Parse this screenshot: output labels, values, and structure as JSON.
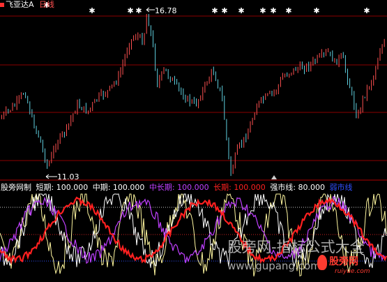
{
  "header": {
    "stock_icon": "red-square-icon",
    "stock_name": "飞亚达A",
    "period": "日线"
  },
  "price_panel": {
    "high_marker": "16.78",
    "low_marker": "11.03",
    "colors": {
      "up": "#ff5050",
      "down": "#5fd0e0",
      "grid": "#8b0000",
      "marker": "#ffffff"
    }
  },
  "indicator_panel": {
    "name": "股旁网制",
    "params": [
      {
        "label": "短期",
        "value": "100.000",
        "color": "#ffffff"
      },
      {
        "label": "中期",
        "value": "100.000",
        "color": "#ffffff"
      },
      {
        "label": "中长期",
        "value": "100.000",
        "color": "#c040ff"
      },
      {
        "label": "长期",
        "value": "100.000",
        "color": "#ff2020"
      },
      {
        "label": "强市线",
        "value": "80.000",
        "color": "#ffffff"
      },
      {
        "label": "弱市线",
        "value": "",
        "color": "#3050ff"
      }
    ],
    "colors": {
      "short": "#fff7a0",
      "mid": "#ffffff",
      "midlong": "#c040ff",
      "long": "#ff2020"
    }
  },
  "watermark": {
    "line1": "股旁网-指标公式大全",
    "line2": "www.gupang.com",
    "badge": "股旁网",
    "badge_sub": "ruiyue.com"
  }
}
